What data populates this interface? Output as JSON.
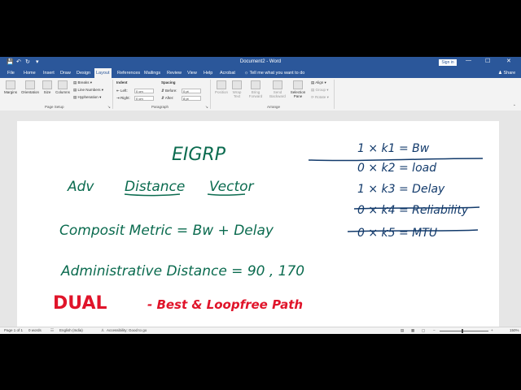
{
  "window": {
    "title": "Document2 - Word",
    "sign_in": "Sign in",
    "controls": [
      "—",
      "☐",
      "✕"
    ]
  },
  "quick_access": {
    "save_icon": "save-icon",
    "undo_icon": "undo-icon",
    "redo_icon": "redo-icon"
  },
  "tabs": [
    {
      "label": "File"
    },
    {
      "label": "Home"
    },
    {
      "label": "Insert"
    },
    {
      "label": "Draw"
    },
    {
      "label": "Design"
    },
    {
      "label": "Layout",
      "active": true
    },
    {
      "label": "References"
    },
    {
      "label": "Mailings"
    },
    {
      "label": "Review"
    },
    {
      "label": "View"
    },
    {
      "label": "Help"
    },
    {
      "label": "Acrobat"
    }
  ],
  "tell_me": "Tell me what you want to do",
  "share": "Share",
  "ribbon": {
    "page_setup": {
      "group_label": "Page Setup",
      "margins": "Margins",
      "orientation": "Orientation",
      "size": "Size",
      "columns": "Columns",
      "breaks": "Breaks",
      "line_numbers": "Line Numbers",
      "hyphenation": "Hyphenation"
    },
    "paragraph": {
      "group_label": "Paragraph",
      "indent_header": "Indent",
      "spacing_header": "Spacing",
      "left_label": "Left:",
      "left_value": "0 cm",
      "right_label": "Right:",
      "right_value": "0 cm",
      "before_label": "Before:",
      "before_value": "0 pt",
      "after_label": "After:",
      "after_value": "8 pt"
    },
    "arrange": {
      "group_label": "Arrange",
      "position": "Position",
      "wrap_text": "Wrap Text",
      "bring_forward": "Bring Forward",
      "send_backward": "Send Backward",
      "selection_pane": "Selection Pane",
      "align": "Align",
      "group": "Group",
      "rotate": "Rotate"
    }
  },
  "document": {
    "handwriting": {
      "title": "EIGRP",
      "line1_a": "Adv",
      "line1_b": "Distance",
      "line1_c": "Vector",
      "line2": "Composit Metric = Bw + Delay",
      "line3": "Administrative Distance = 90 , 170",
      "dual": "DUAL",
      "dual_tail": "- Best & Loopfree Path",
      "k1": "1 × k1 = Bw",
      "k2": "0 × k2 = load",
      "k3": "1 × k3 = Delay",
      "k4": "0 × k4 = Reliability",
      "k5": "0 × k5 = MTU"
    }
  },
  "status": {
    "page": "Page 1 of 1",
    "words": "0 words",
    "language": "English (India)",
    "accessibility": "Accessibility: Good to go",
    "zoom": "150%"
  },
  "colors": {
    "brand": "#2b579a",
    "ink_green": "#0b6b4f",
    "ink_red": "#e0142a",
    "ink_navy": "#123a6b"
  }
}
